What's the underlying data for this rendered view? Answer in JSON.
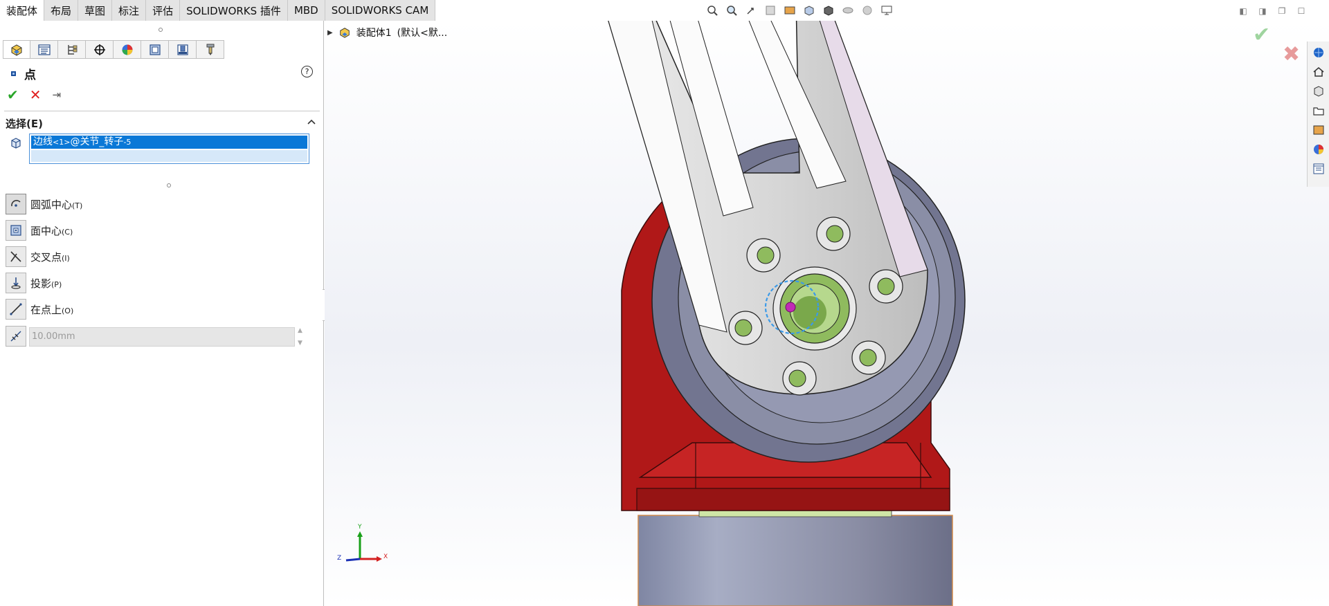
{
  "tabs": [
    "装配体",
    "布局",
    "草图",
    "标注",
    "评估",
    "SOLIDWORKS 插件",
    "MBD",
    "SOLIDWORKS CAM"
  ],
  "panel": {
    "title": "点",
    "help_label": "?",
    "section_title": "选择(E)",
    "selection": {
      "main": "边线",
      "sub1": "<1>",
      "main2": "@关节_转子",
      "sub2": "-5"
    },
    "options": [
      {
        "label": "圆弧中心",
        "hotkey": "(T)"
      },
      {
        "label": "面中心",
        "hotkey": "(C)"
      },
      {
        "label": "交叉点",
        "hotkey": "(I)"
      },
      {
        "label": "投影",
        "hotkey": "(P)"
      },
      {
        "label": "在点上",
        "hotkey": "(O)"
      }
    ],
    "distance_value": "10.00mm"
  },
  "tree": {
    "root_label": "装配体1",
    "config_label": "(默认<默..."
  },
  "axis": {
    "x": "X",
    "y": "Y",
    "z": "Z"
  },
  "colors": {
    "accent_blue": "#0a78d7",
    "ok_green": "#2aa62a",
    "cancel_red": "#e02020",
    "base_red": "#b01818",
    "body_gray": "#7d8196",
    "bore_green": "#8fbb5e",
    "point_magenta": "#c12ab5"
  },
  "icons": {
    "feature_manager": "assembly-icon",
    "property_manager": "property-icon",
    "configuration_manager": "config-icon",
    "dim_expert": "dimxpert-icon",
    "display_manager": "appearance-icon",
    "cam_feature": "cam-icon",
    "cam_operation": "cam-operation-icon",
    "cam_tool": "cam-tool-icon"
  }
}
